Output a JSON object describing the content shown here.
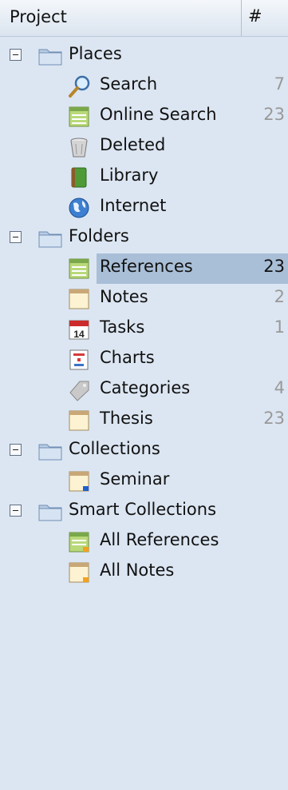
{
  "header": {
    "project_label": "Project",
    "count_label": "#"
  },
  "groups": [
    {
      "label": "Places",
      "items": [
        {
          "label": "Search",
          "count": "7",
          "icon": "search-icon"
        },
        {
          "label": "Online Search",
          "count": "23",
          "icon": "online-search-icon"
        },
        {
          "label": "Deleted",
          "count": "",
          "icon": "trash-icon"
        },
        {
          "label": "Library",
          "count": "",
          "icon": "library-icon"
        },
        {
          "label": "Internet",
          "count": "",
          "icon": "globe-icon"
        }
      ]
    },
    {
      "label": "Folders",
      "items": [
        {
          "label": "References",
          "count": "23",
          "icon": "references-icon",
          "selected": true
        },
        {
          "label": "Notes",
          "count": "2",
          "icon": "notes-icon"
        },
        {
          "label": "Tasks",
          "count": "1",
          "icon": "calendar-icon",
          "calendar_day": "14"
        },
        {
          "label": "Charts",
          "count": "",
          "icon": "chart-icon"
        },
        {
          "label": "Categories",
          "count": "4",
          "icon": "tag-icon"
        },
        {
          "label": "Thesis",
          "count": "23",
          "icon": "thesis-icon"
        }
      ]
    },
    {
      "label": "Collections",
      "items": [
        {
          "label": "Seminar",
          "count": "",
          "icon": "collection-icon"
        }
      ]
    },
    {
      "label": "Smart Collections",
      "items": [
        {
          "label": "All References",
          "count": "",
          "icon": "smart-references-icon"
        },
        {
          "label": "All Notes",
          "count": "",
          "icon": "smart-notes-icon"
        }
      ]
    }
  ]
}
